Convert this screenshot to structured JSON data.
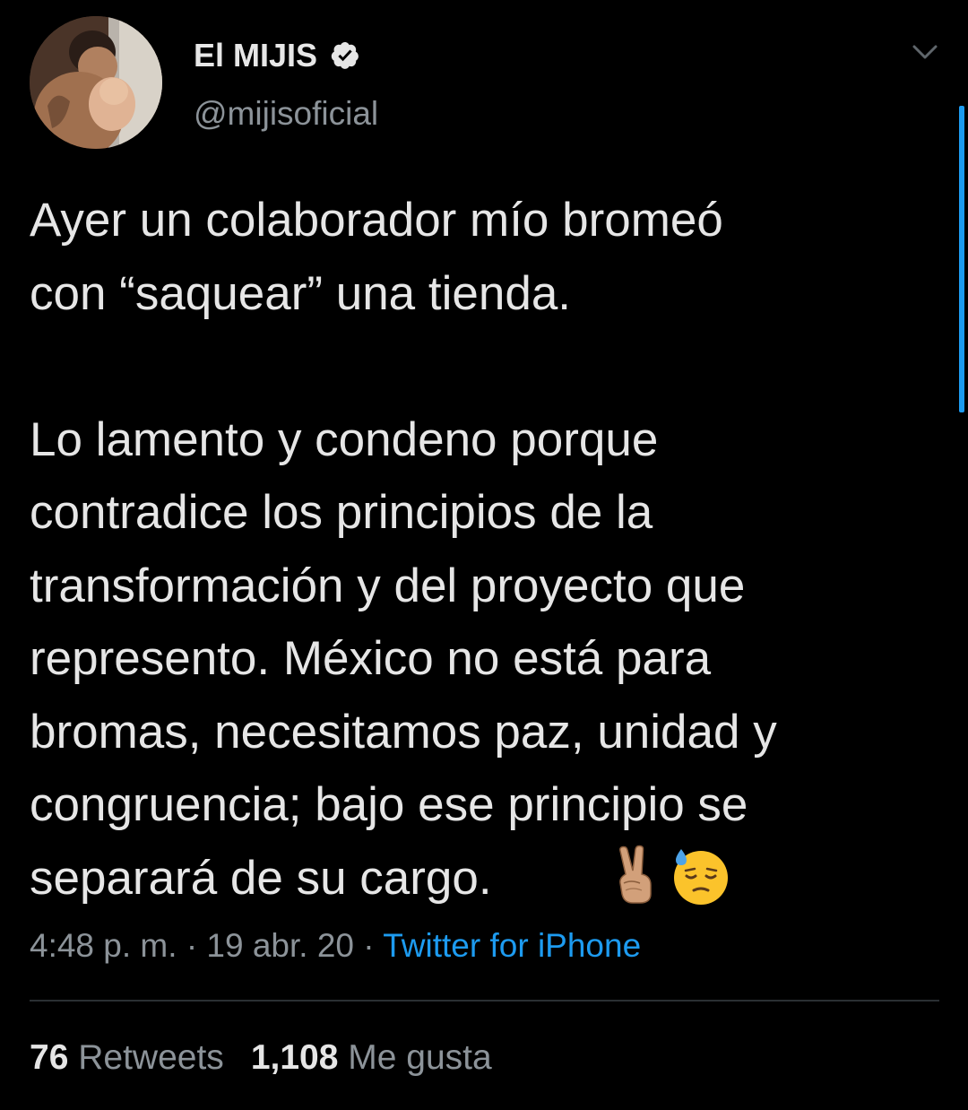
{
  "tweet": {
    "author": {
      "display_name": "El MIJIS",
      "handle": "@mijisoficial",
      "verified": true,
      "avatar_icon": "profile-photo"
    },
    "text": "Ayer un colaborador mío bromeó\ncon “saquear” una tienda.\n\nLo lamento y condeno porque\ncontradice los principios de la\ntransformación y del proyecto que\nrepresento. México no está para\nbromas, necesitamos paz, unidad y\ncongruencia; bajo ese principio se\nseparará de su cargo.",
    "emojis": [
      "victory-hand-emoji",
      "sweat-face-emoji"
    ],
    "time": "4:48 p. m.",
    "date": "19 abr. 20",
    "separator": "·",
    "source": "Twitter for iPhone",
    "stats": {
      "retweets_count": "76",
      "retweets_label": "Retweets",
      "likes_count": "1,108",
      "likes_label": "Me gusta"
    }
  },
  "colors": {
    "background": "#000000",
    "text": "#e6e6e6",
    "secondary_text": "#8c9399",
    "link": "#1d9bf0",
    "divider": "#2a2f33"
  }
}
